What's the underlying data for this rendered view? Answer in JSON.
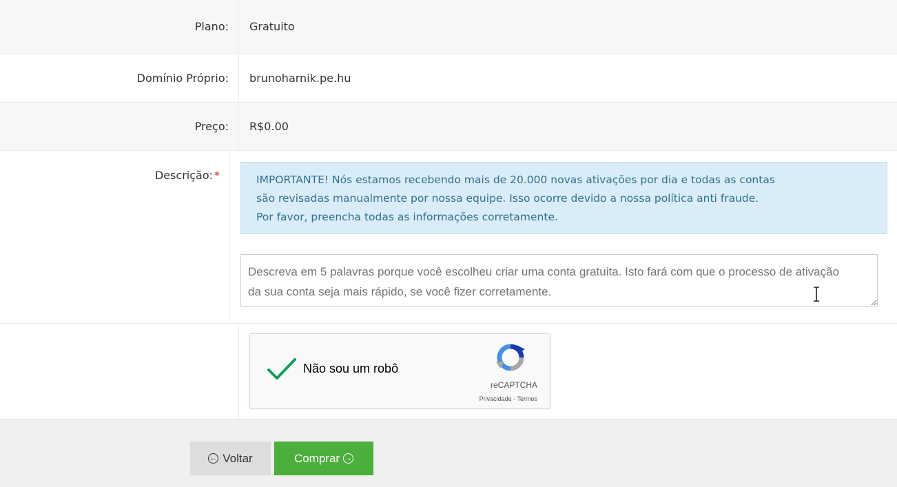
{
  "form": {
    "plan": {
      "label": "Plano:",
      "value": "Gratuito"
    },
    "domain": {
      "label": "Domínio Próprio:",
      "value": "brunoharnik.pe.hu"
    },
    "price": {
      "label": "Preço:",
      "value": "R$0.00"
    },
    "description": {
      "label": "Descrição:",
      "required_mark": "*",
      "alert_lines": [
        "IMPORTANTE! Nós estamos recebendo mais de 20.000 novas ativações por dia e todas as contas",
        "são revisadas manualmente por nossa equipe. Isso ocorre devido a nossa política anti fraude.",
        "Por favor, preencha todas as informações corretamente."
      ],
      "textarea_value": "",
      "textarea_placeholder": "Descreva em 5 palavras porque você escolheu criar uma conta gratuita. Isto fará com que o processo de ativação da sua conta seja mais rápido, se você fizer corretamente."
    }
  },
  "captcha": {
    "label": "Não sou um robô",
    "checked": true,
    "brand": "reCAPTCHA",
    "links": "Privacidade - Termos",
    "icon": "recaptcha-logo-icon",
    "check_color": "#0f9d58"
  },
  "footer": {
    "back_label": "Voltar",
    "back_icon": "arrow-left-circle-icon",
    "buy_label": "Comprar",
    "buy_icon": "arrow-right-circle-icon"
  },
  "colors": {
    "buy_button": "#4cae3c",
    "back_button": "#dddddd",
    "alert_bg": "#d9ecf7",
    "alert_text": "#31708f",
    "required": "#c0392b"
  }
}
